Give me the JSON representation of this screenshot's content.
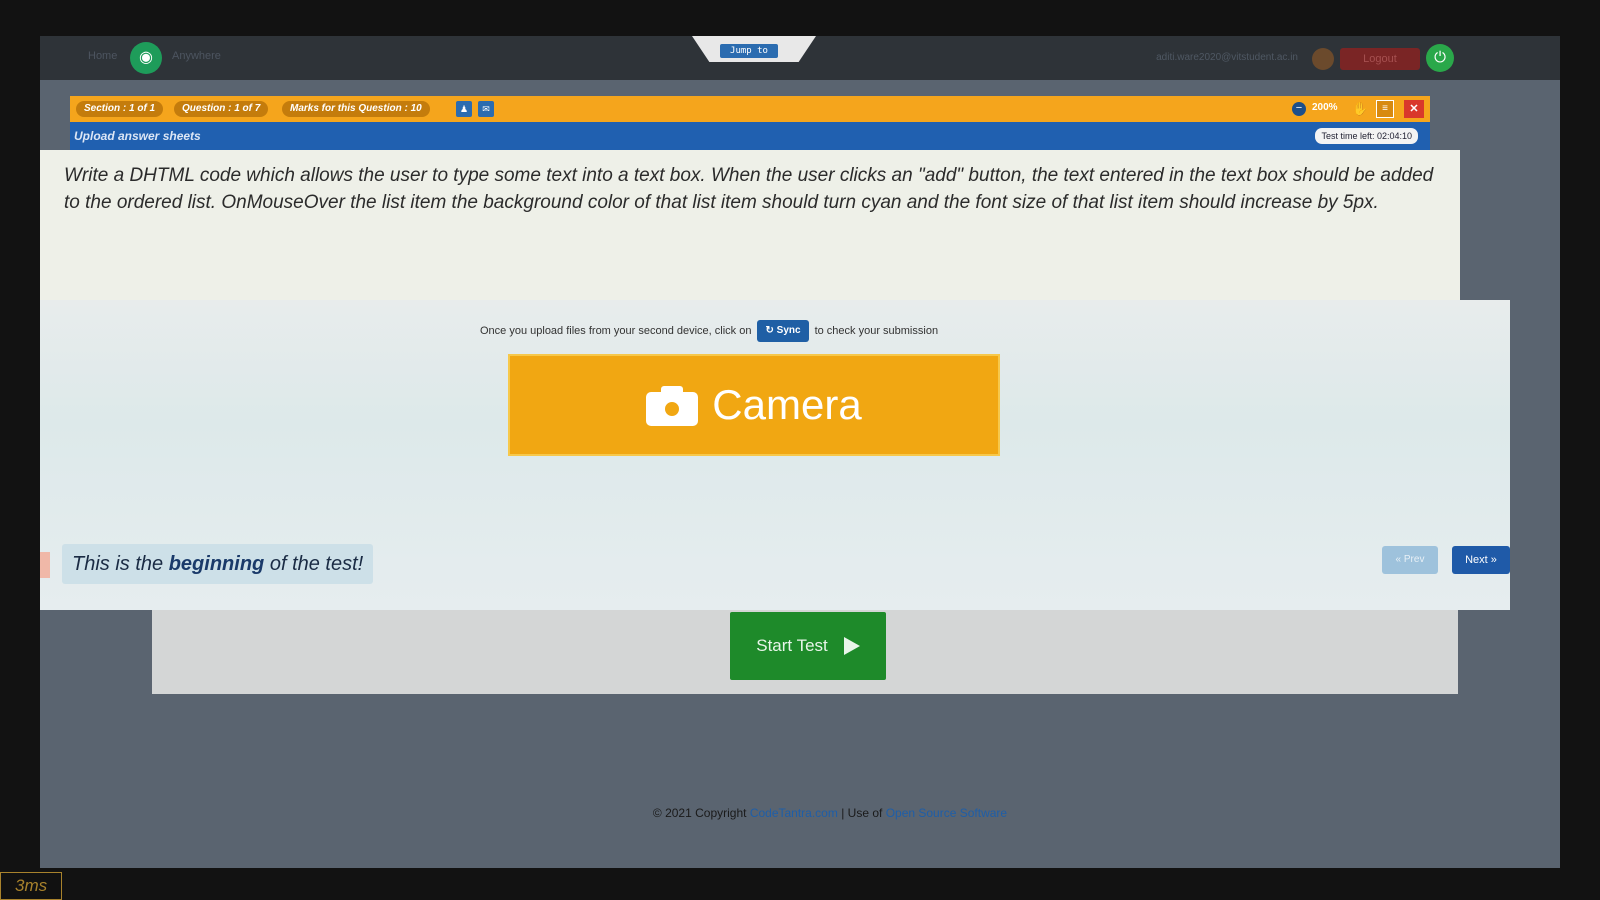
{
  "nav": {
    "home_label": "Home",
    "user_label": "Anywhere",
    "jump_to": "Jump to",
    "user_email": "aditi.ware2020@vitstudent.ac.in",
    "logout_label": "Logout"
  },
  "test_bar": {
    "section": "Section : 1 of 1",
    "question": "Question : 1 of 7",
    "marks": "Marks for this Question : 10",
    "zoom": "200%"
  },
  "upload_bar": {
    "title": "Upload answer sheets",
    "time_left": "Test time left: 02:04:10"
  },
  "question": {
    "text": "Write a DHTML code which allows the user to type some text into a text box. When the user clicks an \"add\" button, the text entered in the text box should be added to the ordered list. OnMouseOver the list item the background color of that list item should turn cyan and the font size of that list item should increase by 5px."
  },
  "upload": {
    "instruction_prefix": "Once you upload files from your second device, click on",
    "sync_label": "Sync",
    "instruction_suffix": "to check your submission",
    "camera_label": "Camera"
  },
  "navigation": {
    "beginning_prefix": "This is the",
    "beginning_bold": "beginning",
    "beginning_suffix": "of the test!",
    "prev_label": "« Prev",
    "next_label": "Next »"
  },
  "start": {
    "label": "Start Test"
  },
  "footer": {
    "copyright": "© 2021 Copyright",
    "brand": "CodeTantra.com",
    "separator": "| Use of",
    "oss_link": "Open Source Software"
  },
  "overlay": {
    "corner_text": "3ms"
  },
  "colors": {
    "accent_orange": "#f5a51c",
    "header_blue": "#2060b0",
    "start_green": "#1e8a2a"
  }
}
